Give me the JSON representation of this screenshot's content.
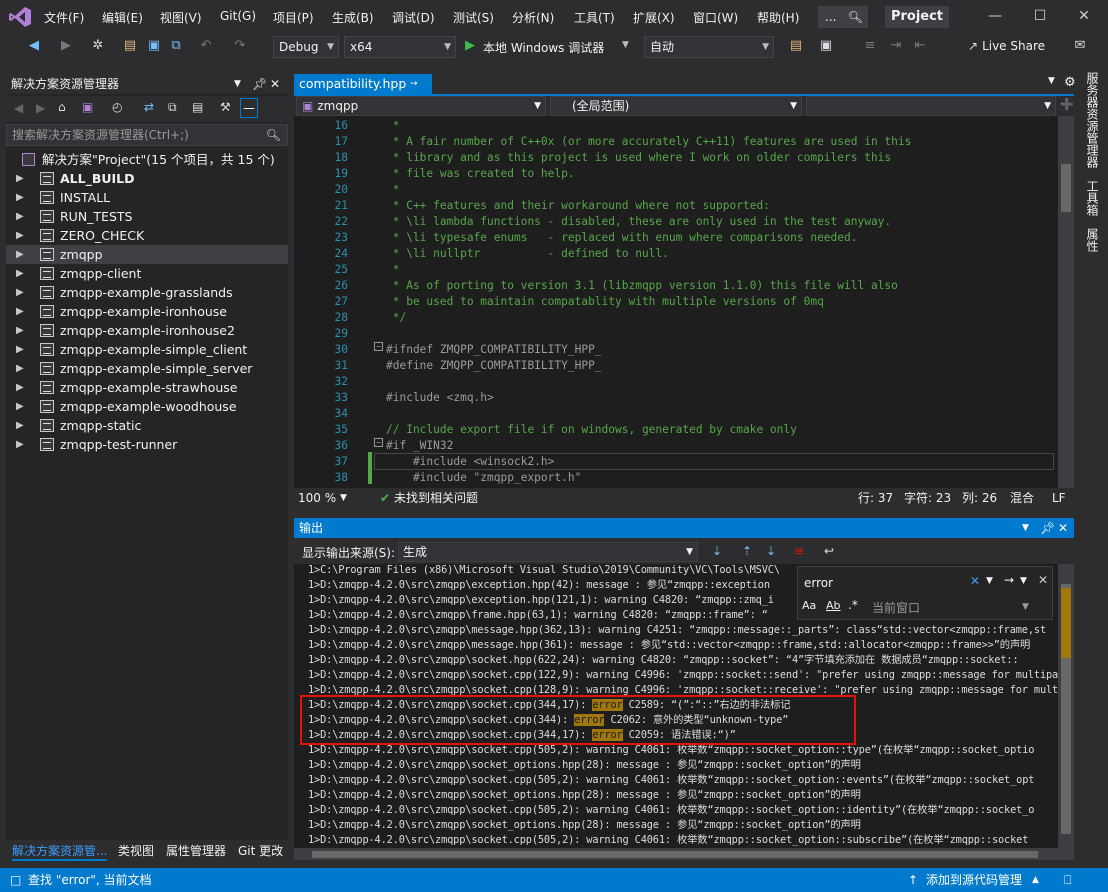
{
  "menu": [
    "文件(F)",
    "编辑(E)",
    "视图(V)",
    "Git(G)",
    "项目(P)",
    "生成(B)",
    "调试(D)",
    "测试(S)",
    "分析(N)",
    "工具(T)",
    "扩展(X)",
    "窗口(W)",
    "帮助(H)"
  ],
  "title": {
    "search_placeholder": "...",
    "project": "Project"
  },
  "toolbar": {
    "config": "Debug",
    "platform": "x64",
    "run_label": "本地 Windows 调试器",
    "mode": "自动",
    "live_share": "Live Share"
  },
  "solution_explorer": {
    "title": "解决方案资源管理器",
    "search_placeholder": "搜索解决方案资源管理器(Ctrl+;)",
    "solution_label": "解决方案\"Project\"(15 个项目，共 15 个)",
    "items": [
      "ALL_BUILD",
      "INSTALL",
      "RUN_TESTS",
      "ZERO_CHECK",
      "zmqpp",
      "zmqpp-client",
      "zmqpp-example-grasslands",
      "zmqpp-example-ironhouse",
      "zmqpp-example-ironhouse2",
      "zmqpp-example-simple_client",
      "zmqpp-example-simple_server",
      "zmqpp-example-strawhouse",
      "zmqpp-example-woodhouse",
      "zmqpp-static",
      "zmqpp-test-runner"
    ],
    "tabs": [
      "解决方案资源管...",
      "类视图",
      "属性管理器",
      "Git 更改"
    ]
  },
  "editor": {
    "tab": "compatibility.hpp",
    "nav_left": "zmqpp",
    "nav_mid": "(全局范围)",
    "nav_right": "",
    "zoom": "100 %",
    "issues": "未找到相关问题",
    "line": "行: 37",
    "char": "字符: 23",
    "col": "列: 26",
    "mixed": "混合",
    "eol": "LF",
    "lines": [
      {
        "n": "16",
        "t": " *"
      },
      {
        "n": "17",
        "t": " * A fair number of C++0x (or more accurately C++11) features are used in this"
      },
      {
        "n": "18",
        "t": " * library and as this project is used where I work on older compilers this"
      },
      {
        "n": "19",
        "t": " * file was created to help."
      },
      {
        "n": "20",
        "t": " *"
      },
      {
        "n": "21",
        "t": " * C++ features and their workaround where not supported:"
      },
      {
        "n": "22",
        "t": " * \\li lambda functions - disabled, these are only used in the test anyway."
      },
      {
        "n": "23",
        "t": " * \\li typesafe enums   - replaced with enum where comparisons needed."
      },
      {
        "n": "24",
        "t": " * \\li nullptr          - defined to null."
      },
      {
        "n": "25",
        "t": " *"
      },
      {
        "n": "26",
        "t": " * As of porting to version 3.1 (libzmqpp version 1.1.0) this file will also"
      },
      {
        "n": "27",
        "t": " * be used to maintain compatablity with multiple versions of 0mq"
      },
      {
        "n": "28",
        "t": " */"
      },
      {
        "n": "29",
        "t": ""
      },
      {
        "n": "30",
        "t": "#ifndef ZMQPP_COMPATIBILITY_HPP_"
      },
      {
        "n": "31",
        "t": "#define ZMQPP_COMPATIBILITY_HPP_"
      },
      {
        "n": "32",
        "t": ""
      },
      {
        "n": "33",
        "t": "#include <zmq.h>"
      },
      {
        "n": "34",
        "t": ""
      },
      {
        "n": "35",
        "t": "// Include export file if on windows, generated by cmake only"
      },
      {
        "n": "36",
        "t": "#if _WIN32"
      },
      {
        "n": "37",
        "t": "    #include <winsock2.h>"
      },
      {
        "n": "38",
        "t": "    #include \"zmqpp_export.h\""
      }
    ]
  },
  "output": {
    "title": "输出",
    "source_label": "显示输出来源(S):",
    "source_value": "生成",
    "find_value": "error",
    "find_scope": "当前窗口",
    "lines": [
      [
        "1>C:\\Program Files (x86)\\Microsoft Visual Studio\\2019\\Community\\VC\\Tools\\MSVC\\"
      ],
      [
        "1>D:\\zmqpp-4.2.0\\src\\zmqpp\\exception.hpp(42): message : 参见“zmqpp::exception"
      ],
      [
        "1>D:\\zmqpp-4.2.0\\src\\zmqpp\\exception.hpp(121,1): warning C4820: “zmqpp::zmq_i"
      ],
      [
        "1>D:\\zmqpp-4.2.0\\src\\zmqpp\\frame.hpp(63,1): warning C4820: “zmqpp::frame”: “"
      ],
      [
        "1>D:\\zmqpp-4.2.0\\src\\zmqpp\\message.hpp(362,13): warning C4251: “zmqpp::message::_parts”: class“std::vector<zmqpp::frame,st"
      ],
      [
        "1>D:\\zmqpp-4.2.0\\src\\zmqpp\\message.hpp(361): message : 参见“std::vector<zmqpp::frame,std::allocator<zmqpp::frame>>”的声明"
      ],
      [
        "1>D:\\zmqpp-4.2.0\\src\\zmqpp\\socket.hpp(622,24): warning C4820: “zmqpp::socket”: “4”字节填充添加在 数据成员“zmqpp::socket::"
      ],
      [
        "1>D:\\zmqpp-4.2.0\\src\\zmqpp\\socket.cpp(122,9): warning C4996: 'zmqpp::socket::send': \"prefer using zmqpp::message for multipar"
      ],
      [
        "1>D:\\zmqpp-4.2.0\\src\\zmqpp\\socket.cpp(128,9): warning C4996: 'zmqpp::socket::receive': \"prefer using zmqpp::message for multi"
      ],
      [
        "1>D:\\zmqpp-4.2.0\\src\\zmqpp\\socket.cpp(344,17): ",
        "error",
        " C2589: “(”:“::”右边的非法标记"
      ],
      [
        "1>D:\\zmqpp-4.2.0\\src\\zmqpp\\socket.cpp(344): ",
        "error",
        " C2062: 意外的类型“unknown-type”"
      ],
      [
        "1>D:\\zmqpp-4.2.0\\src\\zmqpp\\socket.cpp(344,17): ",
        "error",
        " C2059: 语法错误:“)”"
      ],
      [
        "1>D:\\zmqpp-4.2.0\\src\\zmqpp\\socket.cpp(505,2): warning C4061: 枚举数“zmqpp::socket_option::type”(在枚举“zmqpp::socket_optio"
      ],
      [
        "1>D:\\zmqpp-4.2.0\\src\\zmqpp\\socket_options.hpp(28): message : 参见“zmqpp::socket_option”的声明"
      ],
      [
        "1>D:\\zmqpp-4.2.0\\src\\zmqpp\\socket.cpp(505,2): warning C4061: 枚举数“zmqpp::socket_option::events”(在枚举“zmqpp::socket_opt"
      ],
      [
        "1>D:\\zmqpp-4.2.0\\src\\zmqpp\\socket_options.hpp(28): message : 参见“zmqpp::socket_option”的声明"
      ],
      [
        "1>D:\\zmqpp-4.2.0\\src\\zmqpp\\socket.cpp(505,2): warning C4061: 枚举数“zmqpp::socket_option::identity”(在枚举“zmqpp::socket_o"
      ],
      [
        "1>D:\\zmqpp-4.2.0\\src\\zmqpp\\socket_options.hpp(28): message : 参见“zmqpp::socket_option”的声明"
      ],
      [
        "1>D:\\zmqpp-4.2.0\\src\\zmqpp\\socket.cpp(505,2): warning C4061: 枚举数“zmqpp::socket_option::subscribe”(在枚举“zmqpp::socket"
      ]
    ]
  },
  "right_rail": [
    "服务器资源管理器",
    "工具箱",
    "属性"
  ],
  "status": {
    "left": "查找 \"error\", 当前文档",
    "right": "添加到源代码管理"
  },
  "colors": {
    "accent": "#007acc",
    "highlight": "#a0770b",
    "redbox": "#e51400"
  }
}
